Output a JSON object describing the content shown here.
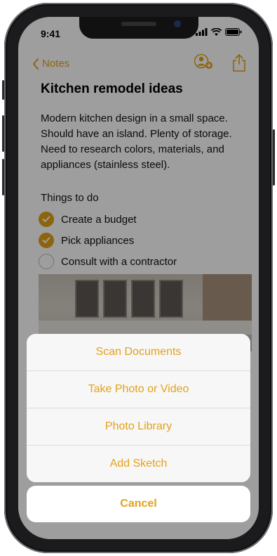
{
  "status_bar": {
    "time": "9:41"
  },
  "nav": {
    "back_label": "Notes"
  },
  "note": {
    "title": "Kitchen remodel ideas",
    "body": "Modern kitchen design in a small space. Should have an island. Plenty of storage. Need to research colors, materials, and appliances (stainless steel).",
    "checklist_heading": "Things to do",
    "checklist": [
      {
        "label": "Create a budget",
        "checked": true
      },
      {
        "label": "Pick appliances",
        "checked": true
      },
      {
        "label": "Consult with a contractor",
        "checked": false
      }
    ]
  },
  "action_sheet": {
    "items": [
      "Scan Documents",
      "Take Photo or Video",
      "Photo Library",
      "Add Sketch"
    ],
    "cancel_label": "Cancel"
  },
  "colors": {
    "accent": "#e3a21a",
    "dim_overlay": "rgba(0,0,0,0.38)"
  }
}
